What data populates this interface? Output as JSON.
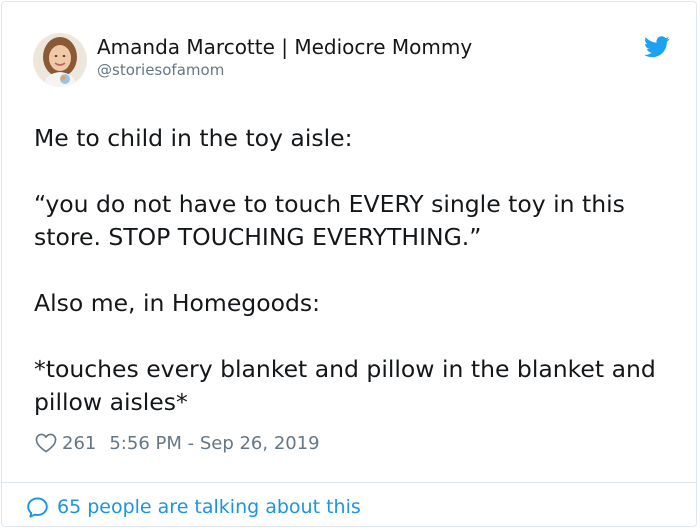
{
  "author": {
    "display_name": "Amanda Marcotte | Mediocre Mommy",
    "handle": "@storiesofamom",
    "avatar_icon": "user-avatar-photo"
  },
  "tweet": {
    "paragraphs": [
      "Me to child in the toy aisle:",
      "“you do not have to touch EVERY single toy in this store. STOP TOUCHING EVERYTHING.”",
      "Also me, in Homegoods:",
      "*touches every blanket and pillow in the blanket and pillow aisles*"
    ]
  },
  "meta": {
    "likes": "261",
    "timestamp": "5:56 PM - Sep 26, 2019",
    "like_icon": "heart-outline-icon"
  },
  "footer": {
    "conversation_label": "65 people are talking about this",
    "conversation_icon": "speech-bubble-icon"
  },
  "brand": {
    "icon": "twitter-bird-icon",
    "color": "#1da1f2",
    "link_color": "#1b95e0",
    "muted_text": "#657786"
  }
}
